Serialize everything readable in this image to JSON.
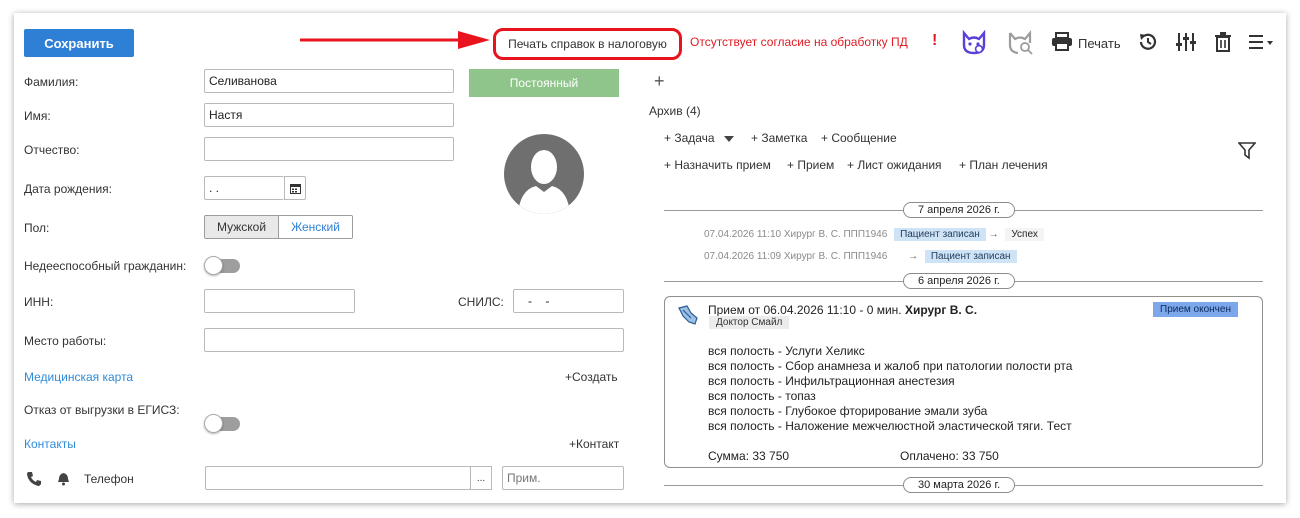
{
  "toolbar": {
    "save_label": "Сохранить",
    "print_tax_label": "Печать справок в налоговую",
    "pd_warning": "Отсутствует согласие на обработку ПД",
    "pd_warning_mark": "!",
    "print_label": "Печать",
    "icons": [
      "cat-link-icon",
      "cat-search-icon",
      "printer-icon",
      "history-icon",
      "sliders-icon",
      "trash-icon",
      "menu-icon"
    ],
    "accent_color": "#2e7fd6",
    "highlight_color": "#e8131c"
  },
  "patient": {
    "surname_label": "Фамилия:",
    "surname_value": "Селиванова",
    "name_label": "Имя:",
    "name_value": "Настя",
    "patronymic_label": "Отчество:",
    "patronymic_value": "",
    "birth_label": "Дата рождения:",
    "birth_value": "  .  .",
    "sex_label": "Пол:",
    "sex_options": [
      "Мужской",
      "Женский"
    ],
    "sex_selected": "Женский",
    "incapable_label": "Недееспособный гражданин:",
    "incapable_on": false,
    "inn_label": "ИНН:",
    "inn_value": "",
    "snils_label": "СНИЛС:",
    "snils_value": "   -    -",
    "work_label": "Место работы:",
    "work_value": "",
    "med_card_label": "Медицинская карта",
    "create_label": "+Создать",
    "egisz_label": "Отказ от выгрузки в ЕГИСЗ:",
    "egisz_on": false,
    "contacts_label": "Контакты",
    "add_contact_label": "+Контакт",
    "phone_label": "Телефон",
    "phone_value": "",
    "phone_note_placeholder": "Прим.",
    "ellipsis_label": "...",
    "status_badge": "Постоянный"
  },
  "right": {
    "add_symbol": "+",
    "archive_label": "Архив (4)",
    "actions_row1": [
      "+ Задача",
      "+ Заметка",
      "+ Сообщение"
    ],
    "actions_row2": [
      "+ Назначить прием",
      "+ Прием",
      "+ Лист ожидания",
      "+ План лечения"
    ],
    "date1": "7 апреля 2026 г.",
    "log1_text": "07.04.2026 11:10 Хирург В. С. ППП1946",
    "log1_chip": "Пациент записан",
    "log1_arrow": "→",
    "log1_result": "Успех",
    "log2_text": "07.04.2026 11:09 Хирург В. С. ППП1946",
    "log2_arrow": "→",
    "log2_chip": "Пациент записан",
    "date2": "6 апреля 2026 г.",
    "date3": "30 марта 2026 г.",
    "card": {
      "title_prefix": "Прием от 06.04.2026 11:10 - 0 мин.",
      "title_doctor": "Хирург В. С.",
      "status": "Прием окончен",
      "doctor_chip": "Доктор Смайл",
      "lines": [
        "вся полость - Услуги Хеликс",
        "вся полость - Сбор анамнеза и жалоб при патологии полости рта",
        "вся полость - Инфильтрационная анестезия",
        "вся полость - топаз",
        "вся полость - Глубокое фторирование эмали зуба",
        "вся полость - Наложение межчелюстной эластической тяги. Тест"
      ],
      "sum_label": "Сумма: 33 750",
      "paid_label": "Оплачено: 33 750"
    }
  }
}
